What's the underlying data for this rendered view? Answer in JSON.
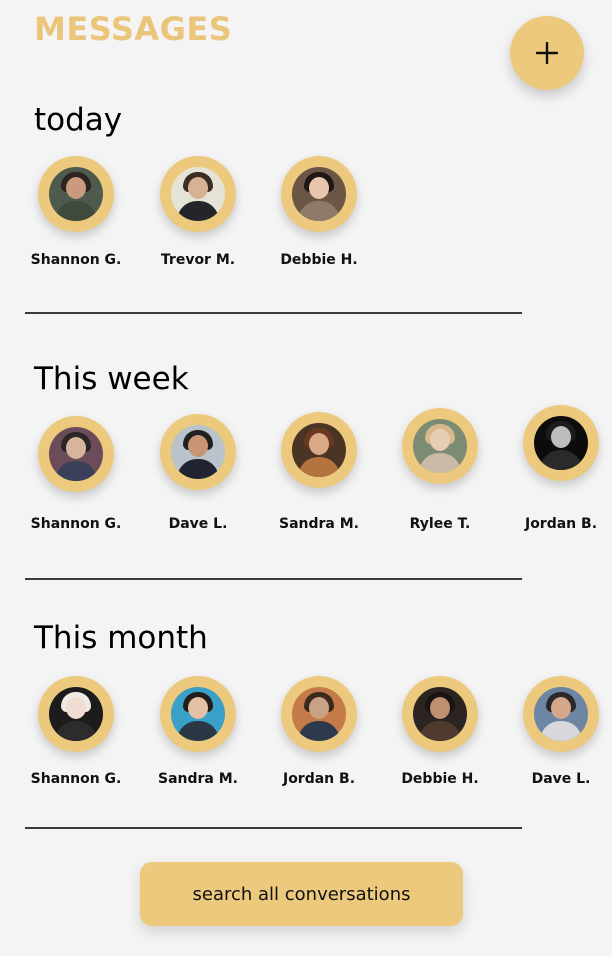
{
  "header": {
    "title": "MESSAGES",
    "new_button_icon": "plus-icon"
  },
  "colors": {
    "accent": "#ecc97c",
    "title": "#eac57a",
    "background": "#f4f4f4",
    "divider": "#3a3a3a"
  },
  "sections": [
    {
      "heading": "today",
      "contacts": [
        {
          "name": "Shannon G.",
          "face": "#c99a7e",
          "hair": "#2b2420",
          "body": "#3f4a3d",
          "bg": "#4d5a4c"
        },
        {
          "name": "Trevor M.",
          "face": "#d8b295",
          "hair": "#3b2d22",
          "body": "#24252a",
          "bg": "#e5e2d6"
        },
        {
          "name": "Debbie H.",
          "face": "#e8c6ae",
          "hair": "#1f1714",
          "body": "#8d7a68",
          "bg": "#6b5544"
        }
      ]
    },
    {
      "heading": "This week",
      "contacts": [
        {
          "name": "Shannon G.",
          "face": "#d7b59c",
          "hair": "#2c2626",
          "body": "#3a3f5a",
          "bg": "#6d4c5a"
        },
        {
          "name": "Dave L.",
          "face": "#c89474",
          "hair": "#202020",
          "body": "#1f2430",
          "bg": "#b8c3cc"
        },
        {
          "name": "Sandra M.",
          "face": "#d9a886",
          "hair": "#6a3a20",
          "body": "#b4743f",
          "bg": "#4a3424"
        },
        {
          "name": "Rylee T.",
          "face": "#e8cdb5",
          "hair": "#d8b98a",
          "body": "#c9b9a6",
          "bg": "#7b8b74"
        },
        {
          "name": "Jordan B.",
          "face": "#bdbdbd",
          "hair": "#1c1c1c",
          "body": "#2a2a2a",
          "bg": "#0c0c0c"
        }
      ]
    },
    {
      "heading": "This month",
      "contacts": [
        {
          "name": "Shannon G.",
          "face": "#f0dcd0",
          "hair": "#eeeae6",
          "body": "#2c2c2c",
          "bg": "#1c1c1c"
        },
        {
          "name": "Sandra M.",
          "face": "#e4c0a4",
          "hair": "#241c18",
          "body": "#2b3644",
          "bg": "#3aa0c8"
        },
        {
          "name": "Jordan B.",
          "face": "#caa184",
          "hair": "#3a2a1e",
          "body": "#2d3a4e",
          "bg": "#c57a4a"
        },
        {
          "name": "Debbie H.",
          "face": "#c09072",
          "hair": "#1a1412",
          "body": "#4f3a2e",
          "bg": "#2c2420"
        },
        {
          "name": "Dave L.",
          "face": "#d4a889",
          "hair": "#2a2a2a",
          "body": "#d8d8dc",
          "bg": "#6c86a4"
        }
      ]
    }
  ],
  "search_button": {
    "label": "search all conversations"
  }
}
